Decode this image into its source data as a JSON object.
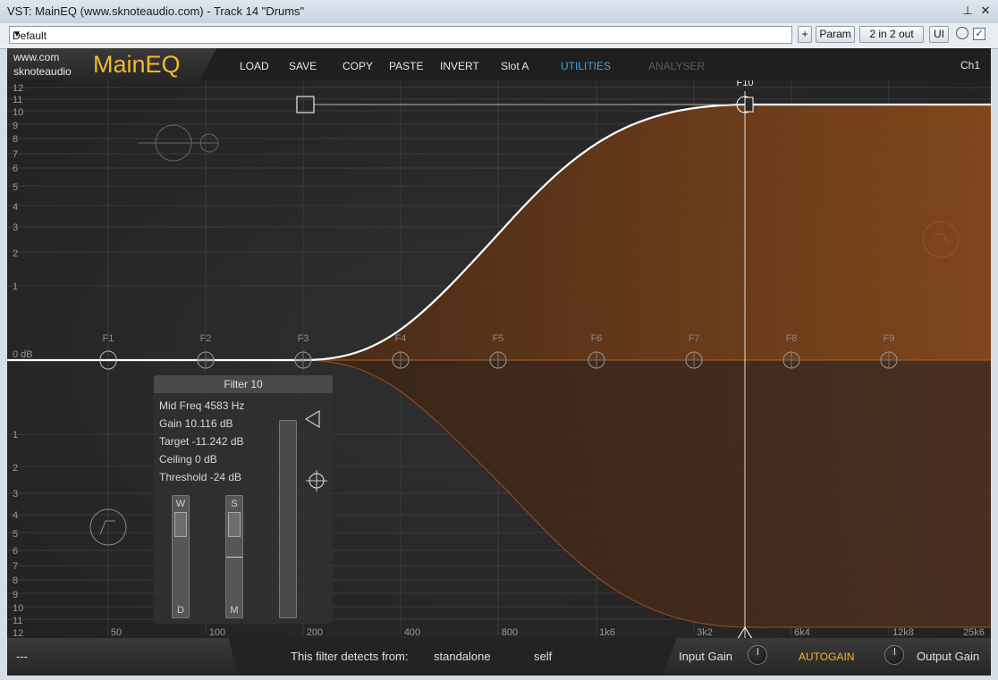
{
  "window": {
    "title": "VST: MainEQ (www.sknoteaudio.com) - Track 14 \"Drums\"",
    "pin_icon": "pin-icon",
    "close_icon": "close-icon"
  },
  "host_toolbar": {
    "preset_value": "Default",
    "plus_label": "+",
    "param_label": "Param",
    "routing_label": "2 in 2 out",
    "ui_label": "UI",
    "checkbox_mark": "✓"
  },
  "plugin": {
    "brand_line1": "www.com",
    "brand_line2": "sknoteaudio",
    "app_name": "MainEQ",
    "menu": [
      "LOAD",
      "SAVE",
      "COPY",
      "PASTE",
      "INVERT",
      "Slot A",
      "UTILITIES",
      "ANALYSER"
    ],
    "channel": "Ch1"
  },
  "graph": {
    "db_labels_top": [
      "12",
      "11",
      "10",
      "9",
      "8",
      "7",
      "6",
      "5",
      "4",
      "3",
      "2",
      "1"
    ],
    "zero_label": "0 dB",
    "db_labels_bottom": [
      "1",
      "2",
      "3",
      "4",
      "5",
      "6",
      "7",
      "8",
      "9",
      "10",
      "11",
      "12"
    ],
    "freq_labels": [
      "50",
      "100",
      "200",
      "400",
      "800",
      "1k6",
      "3k2",
      "6k4",
      "12k8",
      "25k6"
    ],
    "filter_labels": [
      "F1",
      "F2",
      "F3",
      "F4",
      "F5",
      "F6",
      "F7",
      "F8",
      "F9",
      "F10"
    ],
    "accent_color": "#c2621a",
    "curve_color": "#ffffff"
  },
  "filter_panel": {
    "title": "Filter 10",
    "mid_freq": "Mid Freq 4583 Hz",
    "gain": "Gain 10.116 dB",
    "target": "Target -11.242 dB",
    "ceiling": "Ceiling 0 dB",
    "threshold": "Threshold -24 dB",
    "slider_w_top": "W",
    "slider_w_bottom": "D",
    "slider_s_top": "S",
    "slider_s_bottom": "M"
  },
  "footer": {
    "left_text": "---",
    "detects_label": "This filter detects from:",
    "source_option": "standalone",
    "target_option": "self",
    "input_gain_label": "Input Gain",
    "autogain_label": "AUTOGAIN",
    "output_gain_label": "Output Gain"
  }
}
